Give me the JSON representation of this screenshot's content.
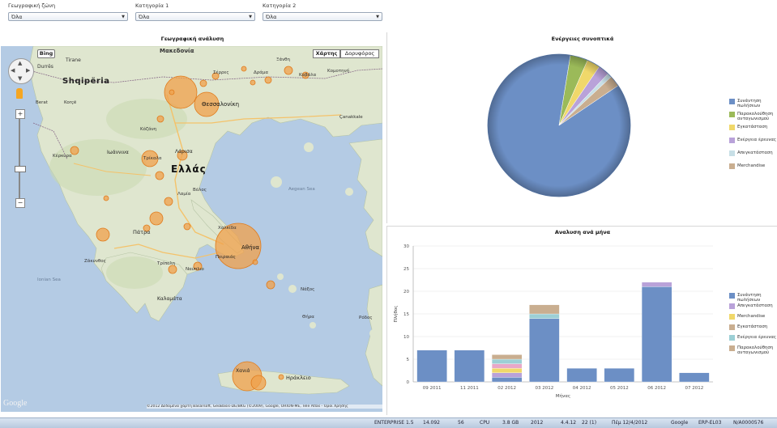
{
  "filters": [
    {
      "label": "Γεωγραφική ζώνη",
      "value": "Όλα"
    },
    {
      "label": "Κατηγορία 1",
      "value": "Όλα"
    },
    {
      "label": "Κατηγορία 2",
      "value": "Όλα"
    }
  ],
  "map_panel": {
    "title": "Γεωγραφική ανάλυση",
    "bing_label": "Bing",
    "map_type_buttons": [
      "Χάρτης",
      "Δορυφόρος"
    ],
    "google_label": "Google",
    "copyright": "©2012 Δεδομένα χάρτη Basarsoft, GeoBasis-DE/BKG (©2009), Google, ORION-ME, Tele Atlas - Όροι Χρήσης",
    "place_labels": [
      {
        "text": "Μακεδονία"
      },
      {
        "text": "Shqipëria"
      },
      {
        "text": "Tirane"
      },
      {
        "text": "Durrës"
      },
      {
        "text": "Θεσσαλονίκη"
      },
      {
        "text": "Ελλάς"
      },
      {
        "text": "Αθήνα"
      },
      {
        "text": "Λάρισα"
      },
      {
        "text": "Ιωάννινα"
      },
      {
        "text": "Πάτρα"
      },
      {
        "text": "Καλαμάτα"
      },
      {
        "text": "Ηράκλειο"
      },
      {
        "text": "Aegean Sea"
      },
      {
        "text": "Ionian Sea"
      },
      {
        "text": "Καβάλα"
      },
      {
        "text": "Κομοτηνή"
      },
      {
        "text": "Κόζάνη"
      },
      {
        "text": "Τρίκαλα"
      },
      {
        "text": "Λαμία"
      },
      {
        "text": "Χαλκίδα"
      },
      {
        "text": "Κέρκυρα"
      },
      {
        "text": "Τρίπολη"
      },
      {
        "text": "Ρόδος"
      },
      {
        "text": "Νάξος"
      },
      {
        "text": "Çanakkale"
      },
      {
        "text": "Θήρα"
      },
      {
        "text": "Ζάκυνθος"
      },
      {
        "text": "Χανιά"
      },
      {
        "text": "Πειραιάς"
      },
      {
        "text": "Σέρρες"
      },
      {
        "text": "Δράμα"
      },
      {
        "text": "Ξάνθη"
      },
      {
        "text": "Korçë"
      },
      {
        "text": "Berat"
      },
      {
        "text": "Βόλος"
      },
      {
        "text": "Ναύπλιο"
      }
    ]
  },
  "pie_panel": {
    "title": "Ενέργειες συνοπτικά",
    "legend": [
      {
        "label": "Συνάντηση πωλήσεων",
        "color": "#6c8fc5"
      },
      {
        "label": "Παρακολούθηση ανταγωνισμού",
        "color": "#9bba59"
      },
      {
        "label": "Εγκατάσταση",
        "color": "#f0d86a"
      },
      {
        "label": "Ενέργεια έρευνας",
        "color": "#b9a2d9"
      },
      {
        "label": "Απεγκατάσταση",
        "color": "#c7dfe6"
      },
      {
        "label": "Merchandise",
        "color": "#c9ae90"
      }
    ]
  },
  "bar_panel": {
    "title": "Αναλυση ανά μήνα",
    "legend": [
      {
        "label": "Συνάντηση πωλήσεων",
        "color": "#6c8fc5"
      },
      {
        "label": "Απεγκατάσταση",
        "color": "#b9a2d9"
      },
      {
        "label": "Merchandise",
        "color": "#f0d86a"
      },
      {
        "label": "Εγκατάσταση",
        "color": "#c9ae90"
      },
      {
        "label": "Ενέργεια έρευνας",
        "color": "#9ccfd5"
      },
      {
        "label": "Παρακολούθηση ανταγωνισμού",
        "color": "#c9ae90"
      }
    ]
  },
  "chart_data": [
    {
      "type": "pie",
      "title": "Ενέργειες συνοπτικά",
      "labels": [
        "Συνάντηση πωλήσεων",
        "Παρακολούθηση ανταγωνισμού",
        "Εγκατάσταση",
        "Ενέργεια έρευνας",
        "Απεγκατάσταση",
        "Merchandise"
      ],
      "values": [
        87,
        4,
        3,
        2.5,
        1,
        2.5
      ],
      "colors": [
        "#6c8fc5",
        "#9bba59",
        "#f0d86a",
        "#b9a2d9",
        "#c7dfe6",
        "#c9ae90"
      ],
      "legend_position": "right"
    },
    {
      "type": "bar",
      "stacked": true,
      "title": "Αναλυση ανά μήνα",
      "xlabel": "Μήνας",
      "ylabel": "Πλήθος",
      "ylim": [
        0,
        30
      ],
      "yticks": [
        0,
        5,
        10,
        15,
        20,
        25,
        30
      ],
      "categories": [
        "09 2011",
        "11 2011",
        "02 2012",
        "03 2012",
        "04 2012",
        "05 2012",
        "06 2012",
        "07 2012"
      ],
      "series": [
        {
          "name": "Συνάντηση πωλήσεων",
          "color": "#6c8fc5",
          "values": [
            7,
            7,
            1,
            14,
            3,
            3,
            21,
            2
          ]
        },
        {
          "name": "Απεγκατάσταση",
          "color": "#b9a2d9",
          "values": [
            0,
            0,
            1,
            0,
            0,
            0,
            1,
            0
          ]
        },
        {
          "name": "Merchandise",
          "color": "#f0d86a",
          "values": [
            0,
            0,
            1,
            0,
            0,
            0,
            0,
            0
          ]
        },
        {
          "name": "Εγκατάσταση",
          "color": "#e8a8c8",
          "values": [
            0,
            0,
            1,
            0,
            0,
            0,
            0,
            0
          ]
        },
        {
          "name": "Ενέργεια έρευνας",
          "color": "#9ccfd5",
          "values": [
            0,
            0,
            1,
            1,
            0,
            0,
            0,
            0
          ]
        },
        {
          "name": "Παρακολούθηση ανταγωνισμού",
          "color": "#c9ae90",
          "values": [
            0,
            0,
            1,
            2,
            0,
            0,
            0,
            0
          ]
        }
      ],
      "grid": true,
      "legend_position": "right"
    }
  ],
  "taskbar": {
    "items": [
      "ENTERPRISE 1.5",
      "14.092",
      "56",
      "CPU",
      "3.8 GB",
      "2012",
      "4.4.12",
      "22 (1)",
      "Πέμ 12/4/2012",
      "Google",
      "ERP-EL03",
      "Ν/Α0000576"
    ]
  }
}
